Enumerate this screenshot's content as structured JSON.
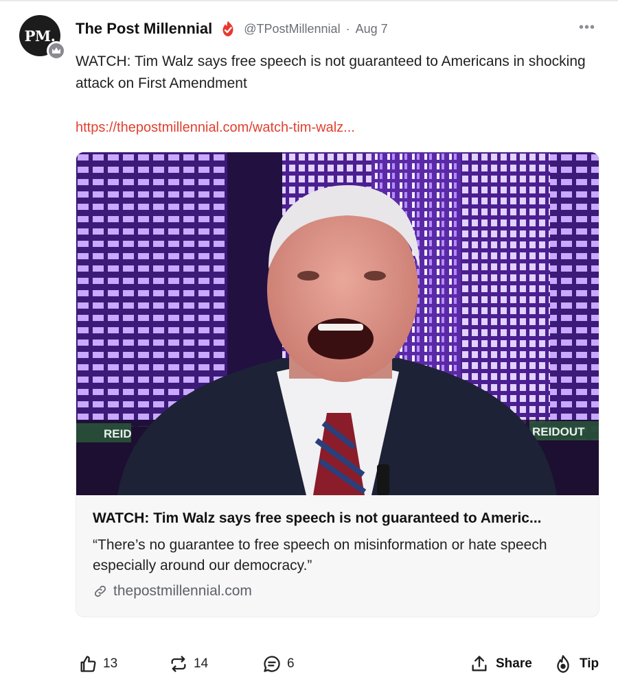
{
  "post": {
    "author": {
      "avatar_text": "PM.",
      "display_name": "The Post Millennial",
      "handle": "@TPostMillennial",
      "verified_icon": "verified-flame-badge",
      "badge_icon": "crown-badge-icon"
    },
    "separator": "·",
    "date": "Aug 7",
    "more_menu": "•••",
    "text": "WATCH: Tim Walz says free speech is not guaranteed to Americans in shocking attack on First Amendment",
    "link": "https://thepostmillennial.com/watch-tim-walz...",
    "colors": {
      "link": "#e0402f",
      "brand_red": "#e8382f",
      "muted": "#6b6f76"
    }
  },
  "card": {
    "image_overlay_left": "REID",
    "image_overlay_right": "REIDOUT",
    "title": "WATCH: Tim Walz says free speech is not guaranteed to Americ...",
    "description": "“There’s no guarantee to free speech on misinformation or hate speech especially around our democracy.”",
    "domain": "thepostmillennial.com"
  },
  "actions": {
    "like": {
      "icon": "thumbs-up-icon",
      "count": "13"
    },
    "repost": {
      "icon": "repost-icon",
      "count": "14"
    },
    "comment": {
      "icon": "comment-icon",
      "count": "6"
    },
    "share": {
      "icon": "share-icon",
      "label": "Share"
    },
    "tip": {
      "icon": "tip-flame-icon",
      "label": "Tip"
    }
  }
}
